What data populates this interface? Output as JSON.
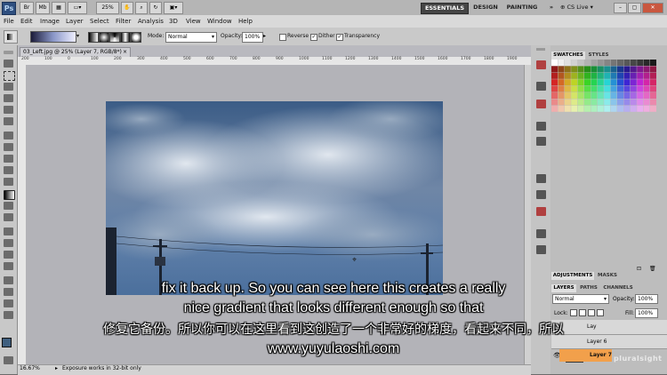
{
  "app": {
    "logo": "Ps",
    "zoom": "25%",
    "workspaces": {
      "essentials": "ESSENTIALS",
      "design": "DESIGN",
      "painting": "PAINTING",
      "more": "»"
    },
    "cs_live": "CS Live"
  },
  "menu": [
    "File",
    "Edit",
    "Image",
    "Layer",
    "Select",
    "Filter",
    "Analysis",
    "3D",
    "View",
    "Window",
    "Help"
  ],
  "options": {
    "mode_label": "Mode:",
    "mode_value": "Normal",
    "opacity_label": "Opacity:",
    "opacity_value": "100%",
    "reverse_label": "Reverse",
    "dither_label": "Dither",
    "transparency_label": "Transparency"
  },
  "document": {
    "tab_title": "03_Left.jpg @ 25% (Layer 7, RGB/8*)",
    "ruler_ticks": [
      "200",
      "100",
      "0",
      "100",
      "200",
      "300",
      "400",
      "500",
      "600",
      "700",
      "800",
      "900",
      "1000",
      "1100",
      "1200",
      "1300",
      "1400",
      "1500",
      "1600",
      "1700",
      "1800",
      "1900"
    ]
  },
  "status": {
    "zoom": "16.67%",
    "message": "Exposure works in 32-bit only"
  },
  "panels": {
    "swatches_tab": "SWATCHES",
    "styles_tab": "STYLES",
    "adjustments_tab": "ADJUSTMENTS",
    "masks_tab": "MASKS",
    "layers_tab": "LAYERS",
    "paths_tab": "PATHS",
    "channels_tab": "CHANNELS",
    "blend_mode": "Normal",
    "opacity_label": "Opacity:",
    "opacity_value": "100%",
    "lock_label": "Lock:",
    "fill_label": "Fill:",
    "fill_value": "100%",
    "layer_partial_1": "Lay",
    "layer_partial_2": "Layer 6",
    "active_layer": "Layer 7"
  },
  "watermark": "pluralsight",
  "subtitles": {
    "line1": "fix it back up. So you can see here this creates a really",
    "line2": "nice gradient that looks different enough so that",
    "line3": "修复它备份。所以你可以在这里看到这创造了一个非常好的梯度，看起来不同，所以",
    "line4": "www.yuyulaoshi.com"
  },
  "colors": {
    "accent_active_layer": "#f2a04b",
    "essentials_bg": "#454545"
  }
}
